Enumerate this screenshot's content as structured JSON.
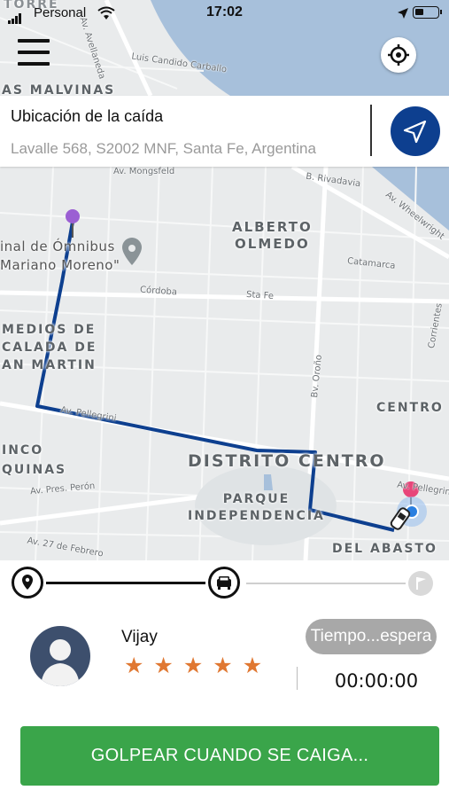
{
  "status_bar": {
    "carrier": "Personal",
    "time": "17:02"
  },
  "map": {
    "top_edge_label": "TORRE",
    "neighborhoods": {
      "malvinas": "AS MALVINAS",
      "alberto_olmedo": [
        "ALBERTO",
        "OLMEDO"
      ],
      "remedios": [
        "MEDIOS DE",
        "CALADA DE",
        "AN MARTIN"
      ],
      "centro": "CENTRO",
      "distrito_centro": "DISTRITO CENTRO",
      "parque": [
        "PARQUE",
        "INDEPENDENCIA"
      ],
      "cinco_esquinas": [
        "INCO",
        "QUINAS"
      ],
      "del_abasto": "DEL ABASTO"
    },
    "terminal": [
      "inal de Ómnibus",
      "Mariano Moreno\""
    ],
    "streets": {
      "avellaneda": "Av. Avellaneda",
      "luis_candido": "Luis Candido Carballo",
      "mongsfeld": "Av. Mongsfeld",
      "rivadavia": "B. Rivadavia",
      "wheelwright": "Av. Wheelwright",
      "catamarca": "Catamarca",
      "cordoba": "Córdoba",
      "sta_fe": "Sta Fe",
      "pellegrini": "Av. Pellegrini",
      "pellegrini_e": "Av. Pellegrini",
      "orono": "Bv. Oroño",
      "corrientes": "Corrientes",
      "peron": "Av. Pres. Perón",
      "febrero": "Av. 27 de Febrero"
    }
  },
  "drop_card": {
    "title": "Ubicación de la caída",
    "address": "Lavalle 568, S2002 MNF, Santa Fe, Argentina"
  },
  "driver": {
    "name": "Vijay",
    "rating_stars": 5,
    "wait_label": "Tiempo...espera",
    "timer": "00:00:00"
  },
  "action": {
    "label": "GOLPEAR CUANDO SE CAIGA..."
  },
  "colors": {
    "route": "#0d3f8f",
    "action_green": "#3aa54a",
    "star": "#e07832",
    "pickup_pin": "#9b5fd3",
    "drop_pin": "#e8457a"
  },
  "icons": {
    "menu": "hamburger-icon",
    "locate": "crosshair-icon",
    "navigate": "paper-plane-icon",
    "start": "location-pin-icon",
    "mid": "car-icon",
    "end": "flag-icon",
    "avatar": "user-silhouette-icon"
  }
}
